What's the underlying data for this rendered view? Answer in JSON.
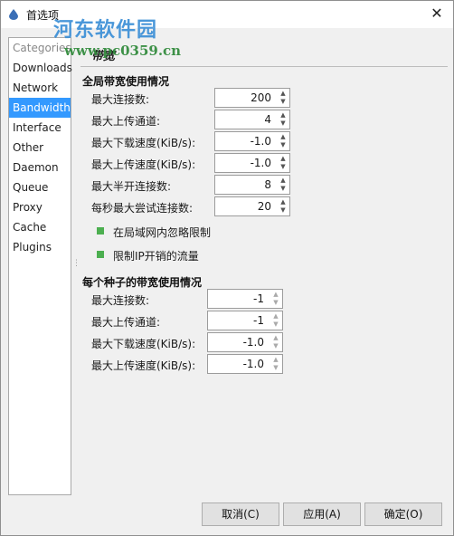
{
  "window": {
    "title": "首选项",
    "close_glyph": "✕"
  },
  "watermark": {
    "text": "河东软件园",
    "url": "www.pc0359.cn"
  },
  "sidebar": {
    "header": "Categories",
    "items": [
      {
        "label": "Downloads"
      },
      {
        "label": "Network"
      },
      {
        "label": "Bandwidth",
        "selected": true
      },
      {
        "label": "Interface"
      },
      {
        "label": "Other"
      },
      {
        "label": "Daemon"
      },
      {
        "label": "Queue"
      },
      {
        "label": "Proxy"
      },
      {
        "label": "Cache"
      },
      {
        "label": "Plugins"
      }
    ]
  },
  "page": {
    "title": "带宽"
  },
  "global": {
    "title": "全局带宽使用情况",
    "fields": [
      {
        "label": "最大连接数:",
        "value": "200"
      },
      {
        "label": "最大上传通道:",
        "value": "4"
      },
      {
        "label": "最大下载速度(KiB/s):",
        "value": "-1.0"
      },
      {
        "label": "最大上传速度(KiB/s):",
        "value": "-1.0"
      },
      {
        "label": "最大半开连接数:",
        "value": "8"
      },
      {
        "label": "每秒最大尝试连接数:",
        "value": "20"
      }
    ],
    "checks": [
      {
        "label": "在局域网内忽略限制",
        "checked": true
      },
      {
        "label": "限制IP开销的流量",
        "checked": true
      }
    ]
  },
  "per_torrent": {
    "title": "每个种子的带宽使用情况",
    "fields": [
      {
        "label": "最大连接数:",
        "value": "-1"
      },
      {
        "label": "最大上传通道:",
        "value": "-1"
      },
      {
        "label": "最大下载速度(KiB/s):",
        "value": "-1.0"
      },
      {
        "label": "最大上传速度(KiB/s):",
        "value": "-1.0"
      }
    ]
  },
  "buttons": {
    "cancel": "取消(C)",
    "apply": "应用(A)",
    "ok": "确定(O)"
  },
  "icons": {
    "app": "droplet-icon",
    "close": "close-icon",
    "spin_up": "▲",
    "spin_down": "▼",
    "splitter": "⋮"
  },
  "colors": {
    "selection": "#3399ff",
    "checkbox": "#4caf50"
  }
}
